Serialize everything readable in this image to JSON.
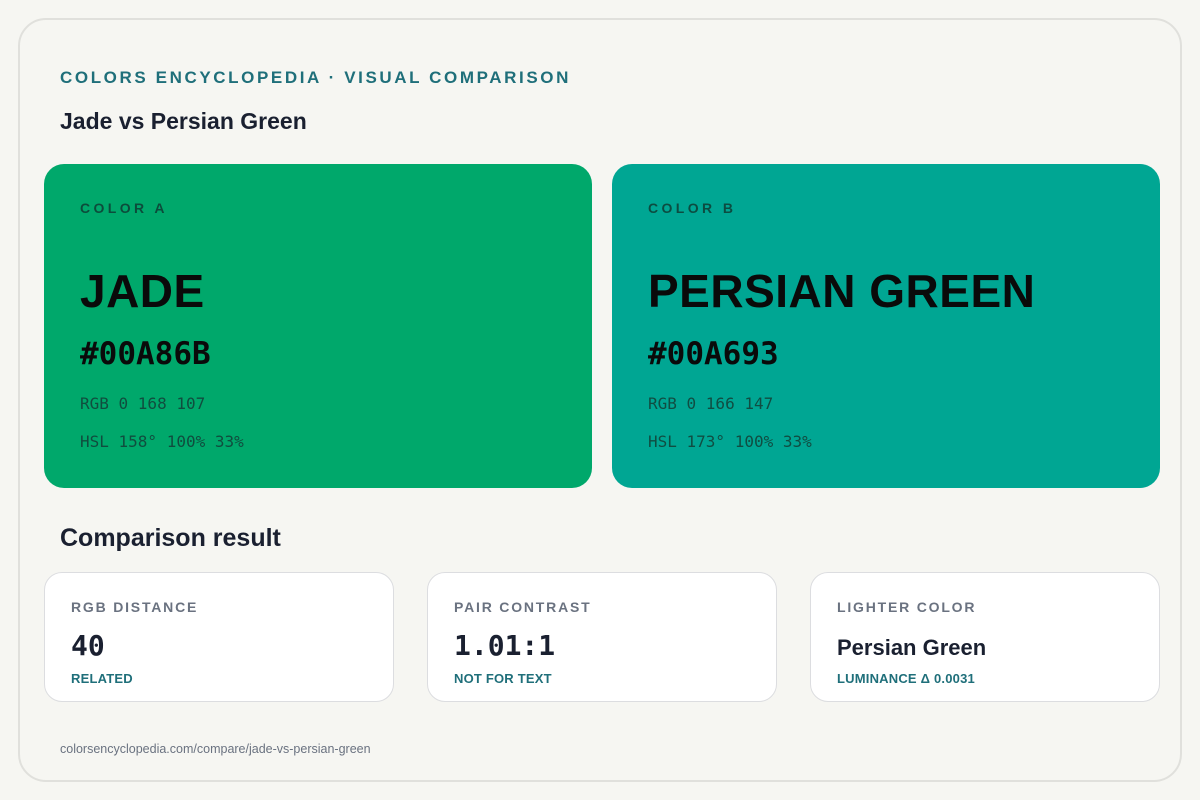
{
  "header": {
    "eyebrow": "COLORS ENCYCLOPEDIA · VISUAL COMPARISON",
    "title": "Jade vs Persian Green"
  },
  "colors": {
    "a": {
      "label": "COLOR A",
      "name": "JADE",
      "hex": "#00A86B",
      "rgb": "RGB 0 168 107",
      "hsl": "HSL 158° 100% 33%",
      "swatch_color": "#00A86B"
    },
    "b": {
      "label": "COLOR B",
      "name": "PERSIAN GREEN",
      "hex": "#00A693",
      "rgb": "RGB 0 166 147",
      "hsl": "HSL 173° 100% 33%",
      "swatch_color": "#00A693"
    }
  },
  "result": {
    "title": "Comparison result",
    "cards": [
      {
        "label": "RGB DISTANCE",
        "value": "40",
        "note": "RELATED"
      },
      {
        "label": "PAIR CONTRAST",
        "value": "1.01:1",
        "note": "NOT FOR TEXT"
      },
      {
        "label": "LIGHTER COLOR",
        "value": "Persian Green",
        "note": "LUMINANCE Δ 0.0031"
      }
    ]
  },
  "footer": {
    "url": "colorsencyclopedia.com/compare/jade-vs-persian-green"
  },
  "theme": {
    "accent": "#1f6f7a",
    "background": "#f6f6f2",
    "text": "#1a2030"
  }
}
